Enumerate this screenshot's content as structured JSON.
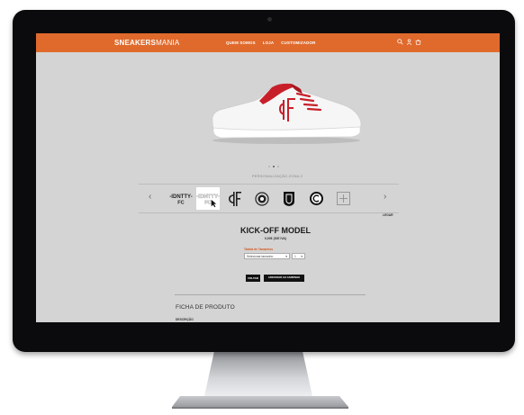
{
  "brand": {
    "bold": "SNEAKERS",
    "light": "MANIA"
  },
  "nav": {
    "links": [
      "QUEM SOMOS",
      "LOJA",
      "CUSTOMIZADOR"
    ]
  },
  "nav_icons": [
    "search-icon",
    "user-icon",
    "cart-icon"
  ],
  "colors": {
    "accent": "#e06a2c",
    "shoe_red": "#c8202a"
  },
  "carousel": {
    "zone_label": "PERSONALIZAÇÃO ZONA 2",
    "prev": "‹",
    "next": "›",
    "slide_indicator": {
      "count": 3,
      "active": 1
    },
    "thumbs": [
      "identity-fc-logo-dark",
      "identity-fc-logo-white",
      "if-monogram",
      "circle-crest",
      "shield-crest",
      "round-badge",
      "add-custom"
    ],
    "selected_index": 1,
    "text_option_label": "LEGAR"
  },
  "product": {
    "title": "KICK-OFF MODEL",
    "price": "0,00€ (S/E IVA)",
    "size_label": "Tabela de Tamanhos",
    "size_select": "Selecionar tamanho",
    "qty": "1",
    "btn_primary": "VOLTAR",
    "btn_secondary": "ADICIONAR AO CARRINHO"
  },
  "sheet": {
    "title": "FICHA DE  PRODUTO",
    "desc_label": "DESCRIÇÃO"
  }
}
